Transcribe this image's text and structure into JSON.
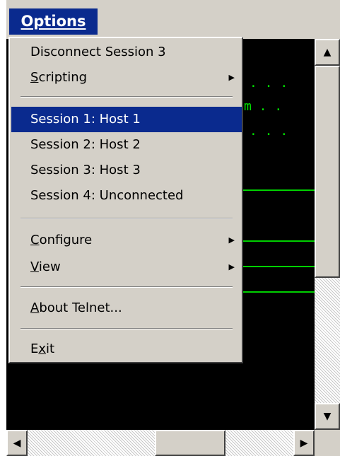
{
  "menubar": {
    "options_label": "Options"
  },
  "menu": {
    "items": [
      {
        "label": "Disconnect Session 3"
      },
      {
        "label": "Scripting",
        "mnemonic_index": 0,
        "submenu": true
      },
      {
        "label": "Session 1: Host 1",
        "highlighted": true
      },
      {
        "label": "Session 2: Host 2"
      },
      {
        "label": "Session 3: Host 3"
      },
      {
        "label": "Session 4: Unconnected"
      },
      {
        "label": "Configure",
        "mnemonic_index": 0,
        "submenu": true
      },
      {
        "label": "View",
        "mnemonic_index": 0,
        "submenu": true
      },
      {
        "label": "About Telnet...",
        "mnemonic_index": 0
      },
      {
        "label": "Exit",
        "mnemonic_index": 1
      }
    ]
  },
  "terminal": {
    "row1": ".  .  .",
    "row2": "m  .  .",
    "row3": ".  .  ."
  },
  "colors": {
    "highlight": "#0a2a8e",
    "terminal_text": "#00e000",
    "menu_bg": "#d4d0c8"
  },
  "icons": {
    "scroll_up": "triangle-up",
    "scroll_down": "triangle-down",
    "scroll_left": "triangle-left",
    "scroll_right": "triangle-right",
    "submenu": "triangle-right"
  }
}
